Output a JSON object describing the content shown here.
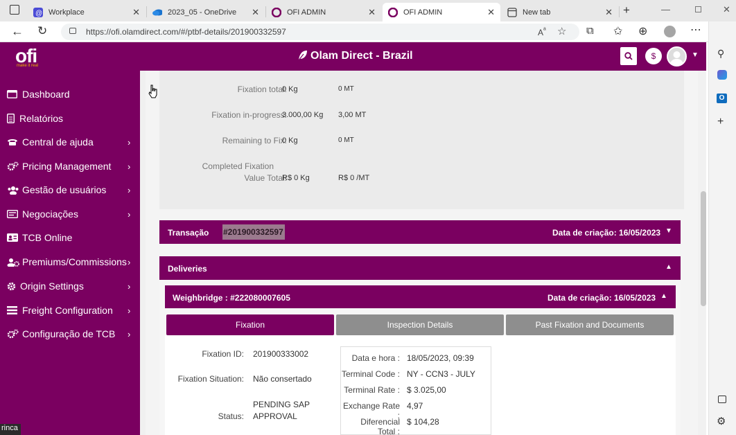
{
  "browser": {
    "tabs": [
      {
        "label": "Workplace",
        "icon": "workplace-icon",
        "active": false
      },
      {
        "label": "2023_05 - OneDrive",
        "icon": "onedrive-icon",
        "active": false
      },
      {
        "label": "OFI ADMIN",
        "icon": "ofi-icon",
        "active": false
      },
      {
        "label": "OFI ADMIN",
        "icon": "ofi-icon",
        "active": true
      },
      {
        "label": "New tab",
        "icon": "newtab-icon",
        "active": false
      }
    ],
    "url": "https://ofi.olamdirect.com/#/ptbf-details/201900332597"
  },
  "header": {
    "logo": "ofi",
    "logo_tagline": "make it real",
    "title": "Olam Direct - Brazil",
    "currency_symbol": "$",
    "accent_color": "#7a0060"
  },
  "sidebar": {
    "items": [
      {
        "label": "Dashboard",
        "icon": "dashboard-icon",
        "has_submenu": false
      },
      {
        "label": "Relatórios",
        "icon": "report-icon",
        "has_submenu": false
      },
      {
        "label": "Central de ajuda",
        "icon": "phone-icon",
        "has_submenu": true
      },
      {
        "label": "Pricing Management",
        "icon": "cogs-icon",
        "has_submenu": true
      },
      {
        "label": "Gestão de usuários",
        "icon": "users-icon",
        "has_submenu": true
      },
      {
        "label": "Negociações",
        "icon": "contract-icon",
        "has_submenu": true
      },
      {
        "label": "TCB Online",
        "icon": "id-card-icon",
        "has_submenu": false
      },
      {
        "label": "Premiums/Commissions",
        "icon": "user-cog-icon",
        "has_submenu": true
      },
      {
        "label": "Origin Settings",
        "icon": "gear-icon",
        "has_submenu": true
      },
      {
        "label": "Freight Configuration",
        "icon": "list-icon",
        "has_submenu": true
      },
      {
        "label": "Configuração de TCB",
        "icon": "cogs-icon",
        "has_submenu": true
      }
    ],
    "tooltip_fragment": "rinca"
  },
  "fixation_summary": [
    {
      "label": "Fixation total:",
      "kg": "0 Kg",
      "mt": "0 MT"
    },
    {
      "label": "Fixation in-progress:",
      "kg": "3.000,00 Kg",
      "mt": "3,00 MT"
    },
    {
      "label": "Remaining to Fix:",
      "kg": "0 Kg",
      "mt": "0 MT"
    },
    {
      "label_line1": "Completed Fixation",
      "label_line2": "Value Total:",
      "kg": "R$ 0 Kg",
      "mt": "R$ 0 /MT"
    }
  ],
  "transaction": {
    "label": "Transação",
    "number": "#201900332597",
    "created_label": "Data de criação: 16/05/2023"
  },
  "deliveries": {
    "label": "Deliveries"
  },
  "weighbridge": {
    "label": "Weighbridge : #222080007605",
    "created_label": "Data de criação: 16/05/2023"
  },
  "subtabs": [
    {
      "label": "Fixation",
      "active": true
    },
    {
      "label": "Inspection Details",
      "active": false
    },
    {
      "label": "Past Fixation and Documents",
      "active": false
    }
  ],
  "fixation_detail": {
    "id_label": "Fixation ID:",
    "id_value": "201900333002",
    "situation_label": "Fixation Situation:",
    "situation_value": "Não consertado",
    "status_label": "Status:",
    "status_value_line1": "PENDING SAP",
    "status_value_line2": "APPROVAL"
  },
  "info_box": [
    {
      "label": "Data e hora :",
      "value": "18/05/2023, 09:39"
    },
    {
      "label": "Terminal Code :",
      "value": "NY - CCN3 - JULY"
    },
    {
      "label": "Terminal Rate :",
      "value": "$ 3.025,00"
    },
    {
      "label": "Exchange Rate :",
      "value": "4,97"
    },
    {
      "label": "Diferencial Total :",
      "value": "$ 104,28"
    }
  ]
}
